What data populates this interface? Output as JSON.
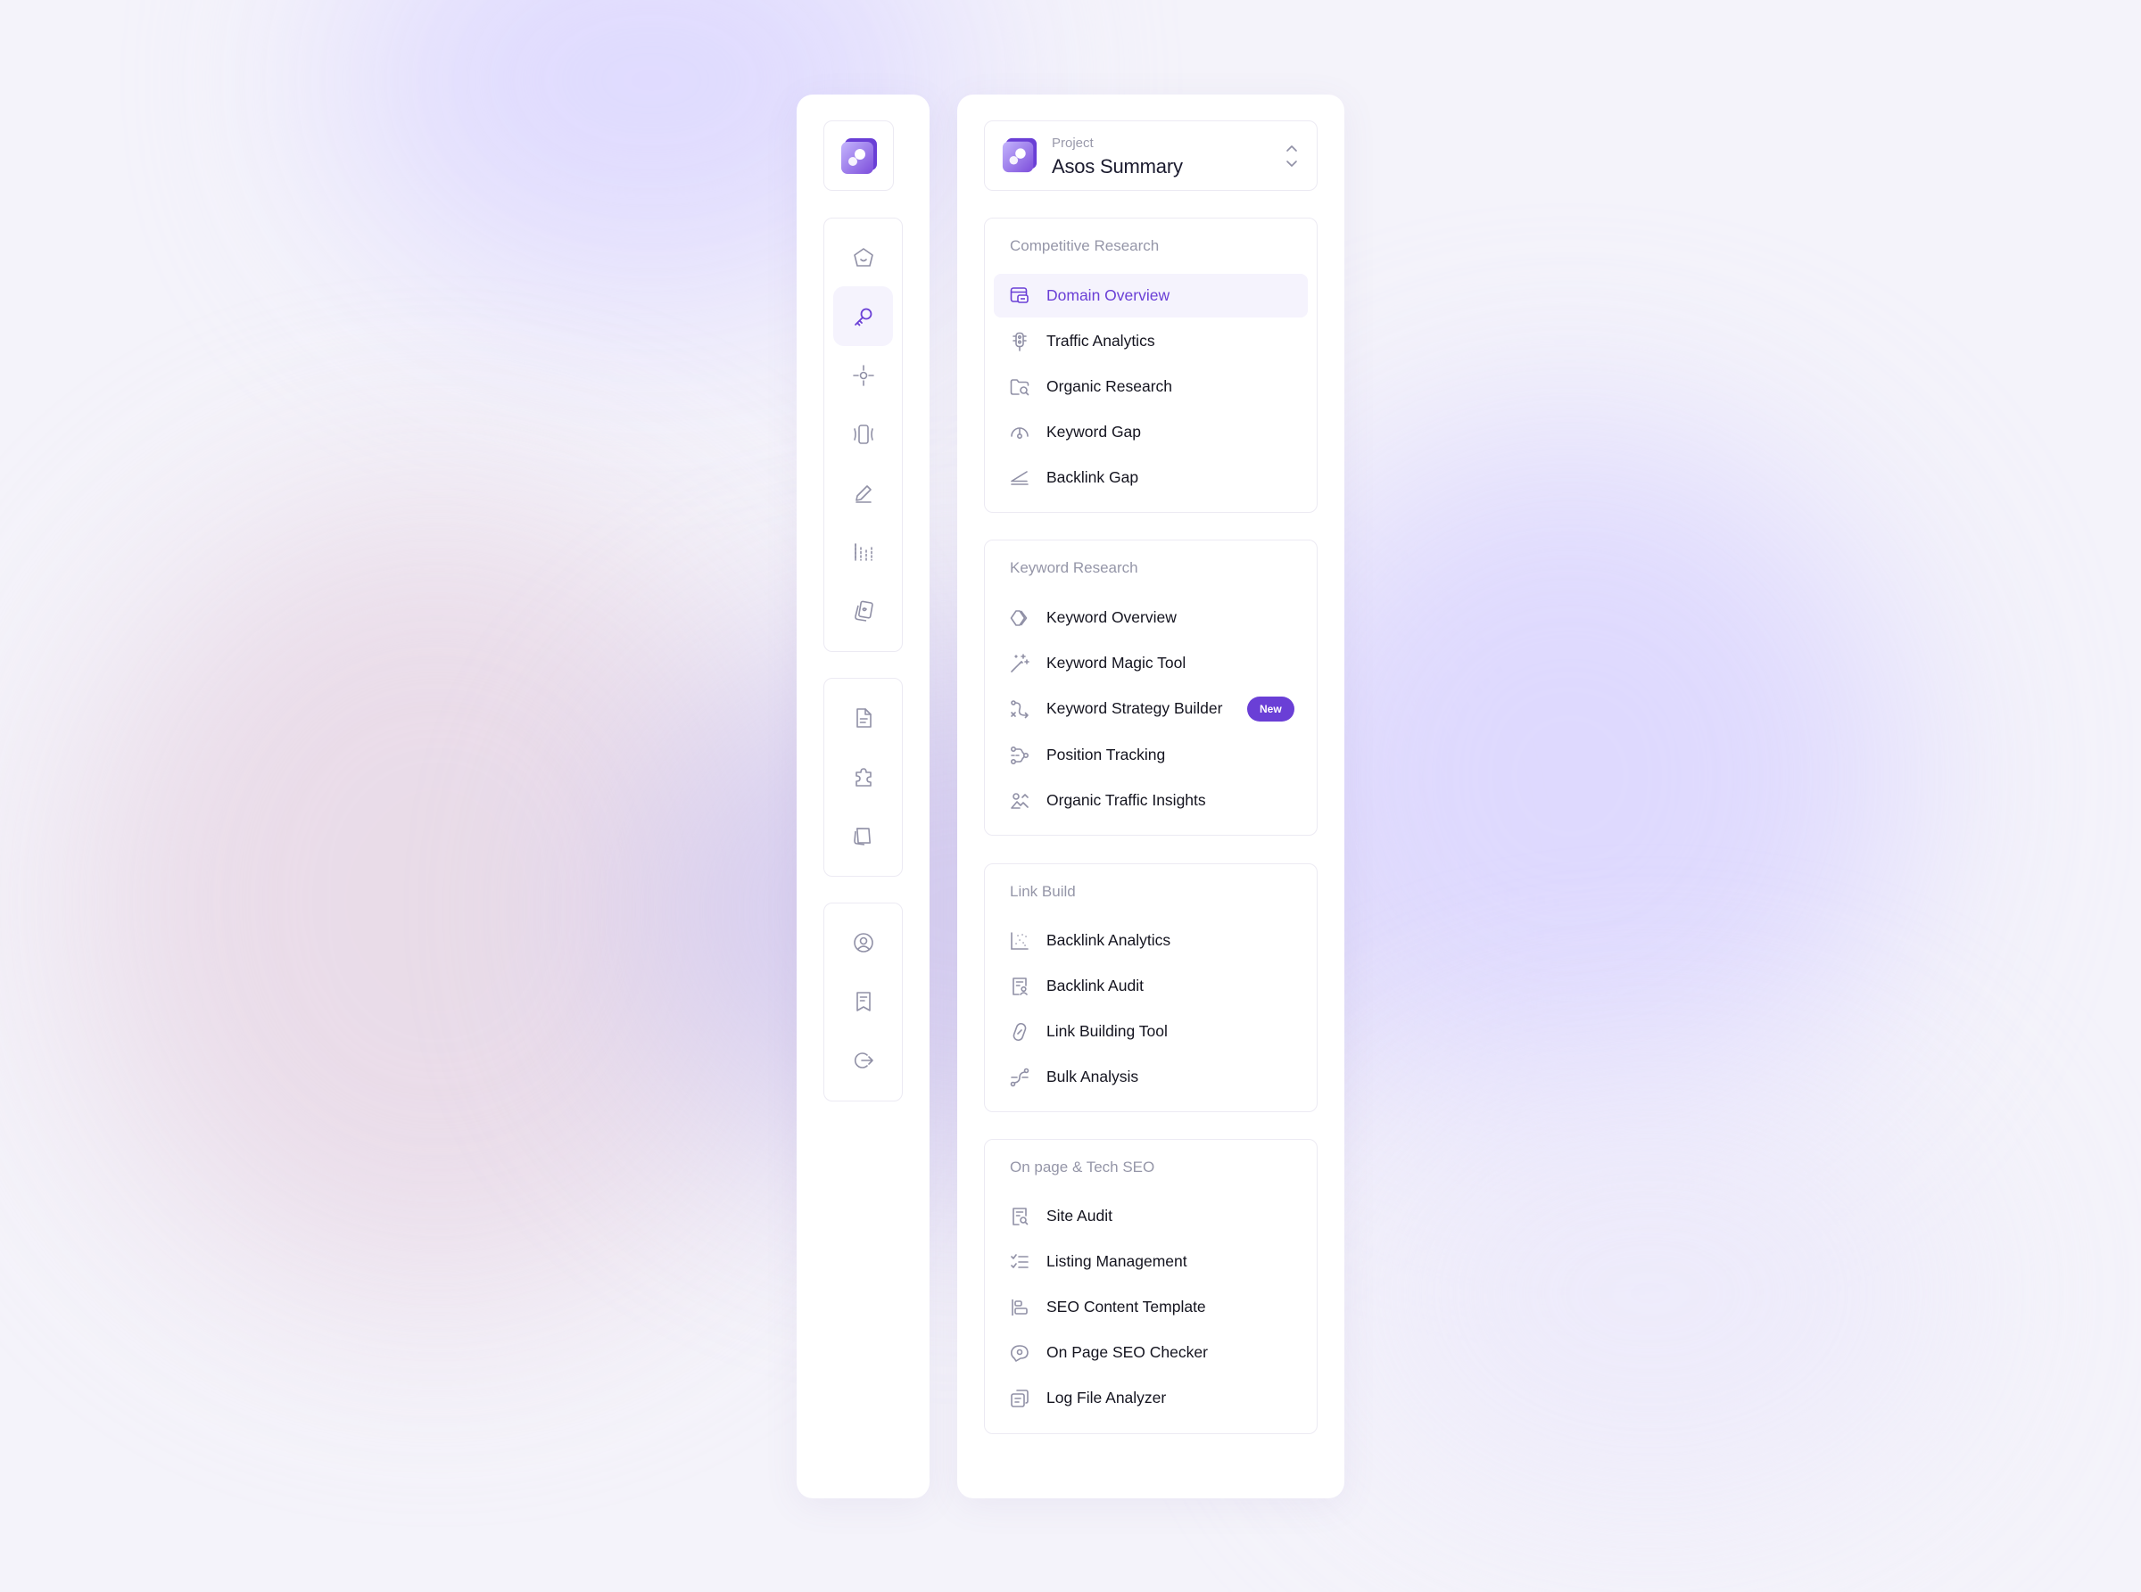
{
  "colors": {
    "accent": "#6a3fd6",
    "icon": "#9090a6",
    "active_bg": "#f5f3fd"
  },
  "rail": {
    "logo": "app-logo",
    "groups": [
      {
        "items": [
          {
            "icon": "home-icon"
          },
          {
            "icon": "key-icon",
            "active": true
          },
          {
            "icon": "target-icon"
          },
          {
            "icon": "vibration-icon"
          },
          {
            "icon": "pencil-icon"
          },
          {
            "icon": "bars-icon"
          },
          {
            "icon": "cards-icon"
          }
        ]
      },
      {
        "items": [
          {
            "icon": "document-icon"
          },
          {
            "icon": "puzzle-icon"
          },
          {
            "icon": "notes-icon"
          }
        ]
      },
      {
        "items": [
          {
            "icon": "user-circle-icon"
          },
          {
            "icon": "receipt-icon"
          },
          {
            "icon": "logout-icon"
          }
        ]
      }
    ]
  },
  "project": {
    "label": "Project",
    "name": "Asos Summary"
  },
  "sections": [
    {
      "title": "Competitive Research",
      "items": [
        {
          "label": "Domain Overview",
          "icon": "browser-icon",
          "active": true
        },
        {
          "label": "Traffic Analytics",
          "icon": "traffic-light-icon"
        },
        {
          "label": "Organic Research",
          "icon": "folder-search-icon"
        },
        {
          "label": "Keyword Gap",
          "icon": "gauge-icon"
        },
        {
          "label": "Backlink Gap",
          "icon": "angle-icon"
        }
      ]
    },
    {
      "title": "Keyword Research",
      "items": [
        {
          "label": "Keyword Overview",
          "icon": "diamond-icon"
        },
        {
          "label": "Keyword Magic Tool",
          "icon": "magic-wand-icon"
        },
        {
          "label": "Keyword Strategy Builder",
          "icon": "route-icon",
          "badge": "New"
        },
        {
          "label": "Position Tracking",
          "icon": "nodes-icon"
        },
        {
          "label": "Organic Traffic Insights",
          "icon": "image-chart-icon"
        }
      ]
    },
    {
      "title": "Link Build",
      "items": [
        {
          "label": "Backlink Analytics",
          "icon": "scatter-icon"
        },
        {
          "label": "Backlink Audit",
          "icon": "file-user-icon"
        },
        {
          "label": "Link Building Tool",
          "icon": "link-icon"
        },
        {
          "label": "Bulk Analysis",
          "icon": "curve-icon"
        }
      ]
    },
    {
      "title": "On page & Tech SEO",
      "items": [
        {
          "label": "Site Audit",
          "icon": "file-search-icon"
        },
        {
          "label": "Listing Management",
          "icon": "checklist-icon"
        },
        {
          "label": "SEO Content Template",
          "icon": "align-left-icon"
        },
        {
          "label": "On Page SEO Checker",
          "icon": "chat-icon"
        },
        {
          "label": "Log File Analyzer",
          "icon": "files-icon"
        }
      ]
    }
  ]
}
